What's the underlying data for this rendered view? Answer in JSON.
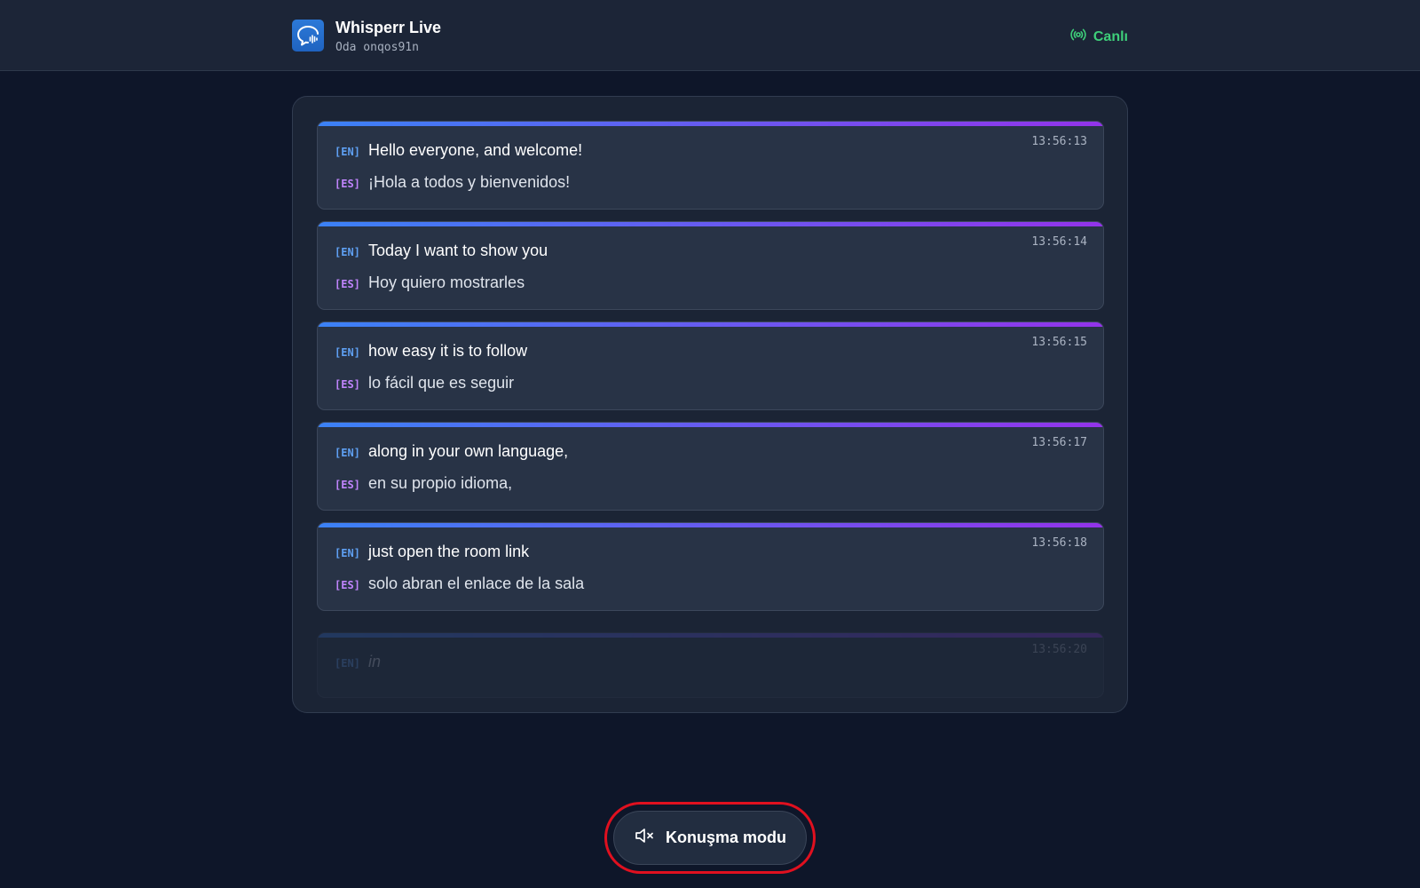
{
  "header": {
    "app_title": "Whisperr Live",
    "room_label": "Oda onqos91n",
    "status_label": "Canlı",
    "status_color": "#3ecf7a",
    "logo_icon": "chat-bubble-waveform-icon"
  },
  "transcript": {
    "entries": [
      {
        "time": "13:56:13",
        "en_tag": "[EN]",
        "en": "Hello everyone, and welcome!",
        "es_tag": "[ES]",
        "es": "¡Hola a todos y bienvenidos!"
      },
      {
        "time": "13:56:14",
        "en_tag": "[EN]",
        "en": "Today I want to show you",
        "es_tag": "[ES]",
        "es": "Hoy quiero mostrarles"
      },
      {
        "time": "13:56:15",
        "en_tag": "[EN]",
        "en": "how easy it is to follow",
        "es_tag": "[ES]",
        "es": "lo fácil que es seguir"
      },
      {
        "time": "13:56:17",
        "en_tag": "[EN]",
        "en": "along in your own language,",
        "es_tag": "[ES]",
        "es": "en su propio idioma,"
      },
      {
        "time": "13:56:18",
        "en_tag": "[EN]",
        "en": "just open the room link",
        "es_tag": "[ES]",
        "es": "solo abran el enlace de la sala"
      }
    ],
    "pending": {
      "time": "13:56:20",
      "en_tag": "[EN]",
      "en": "in"
    }
  },
  "controls": {
    "speak_mode_label": "Konuşma modu",
    "speak_mode_icon": "speaker-muted-icon",
    "highlight_color": "#e0101f"
  },
  "colors": {
    "accent_blue": "#3b82f6",
    "accent_purple": "#9333ea",
    "en_tag": "#5fa0f3",
    "es_tag": "#c084fc"
  }
}
